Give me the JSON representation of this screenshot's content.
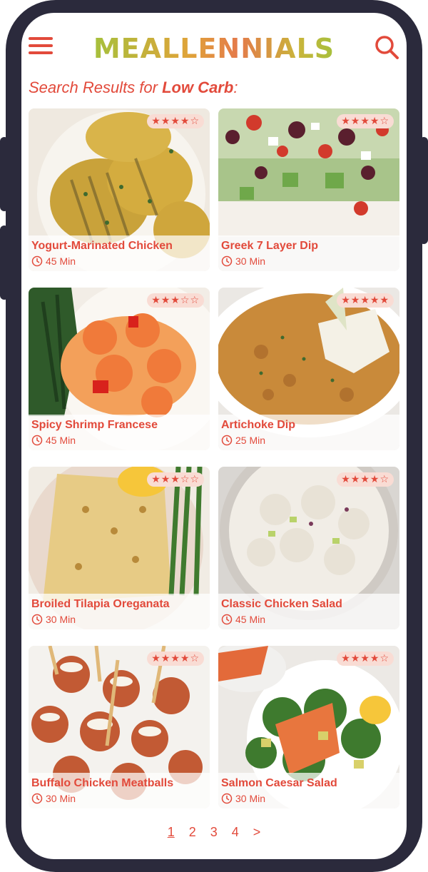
{
  "header": {
    "logo_text": "MEALLENNIALS",
    "menu_icon": "hamburger-menu-icon",
    "search_icon": "search-icon",
    "accent_color": "#e24a3b"
  },
  "search": {
    "prefix": "Search Results for ",
    "query": "Low Carb",
    "suffix": ":"
  },
  "recipes": [
    {
      "name": "Yogurt-Marinated Chicken",
      "time": "45 Min",
      "stars": "★★★★☆"
    },
    {
      "name": "Greek 7 Layer Dip",
      "time": "30 Min",
      "stars": "★★★★☆"
    },
    {
      "name": "Spicy Shrimp Francese",
      "time": "45 Min",
      "stars": "★★★☆☆"
    },
    {
      "name": "Artichoke Dip",
      "time": "25 Min",
      "stars": "★★★★★"
    },
    {
      "name": "Broiled Tilapia Oreganata",
      "time": "30 Min",
      "stars": "★★★☆☆"
    },
    {
      "name": "Classic Chicken Salad",
      "time": "45 Min",
      "stars": "★★★★☆"
    },
    {
      "name": "Buffalo Chicken Meatballs",
      "time": "30 Min",
      "stars": "★★★★☆"
    },
    {
      "name": "Salmon Caesar Salad",
      "time": "30 Min",
      "stars": "★★★★☆"
    }
  ],
  "pagination": {
    "pages": [
      "1",
      "2",
      "3",
      "4"
    ],
    "next": ">",
    "current": "1"
  }
}
